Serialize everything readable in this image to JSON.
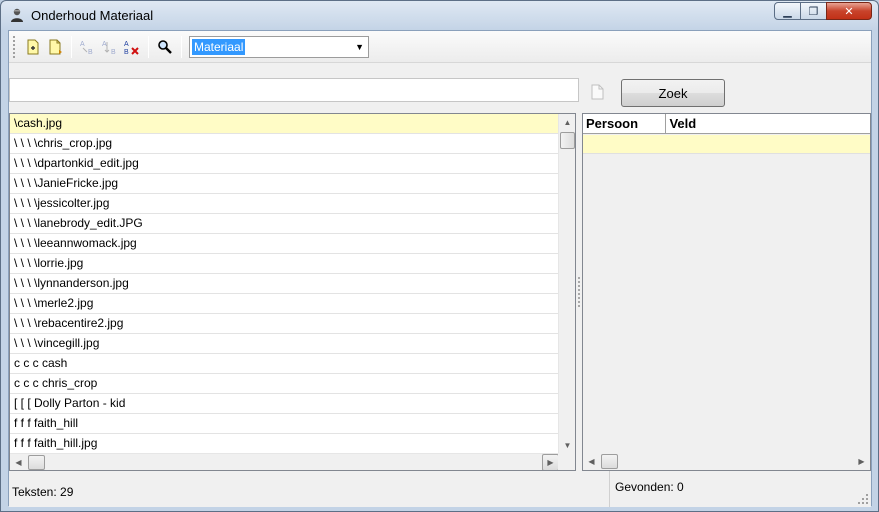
{
  "window": {
    "title": "Onderhoud Materiaal",
    "minimize_glyph": "▁",
    "maximize_glyph": "❐",
    "close_glyph": "✕"
  },
  "toolbar": {
    "buttons": [
      {
        "name": "new-record-icon",
        "enabled": true
      },
      {
        "name": "new-document-icon",
        "enabled": true
      },
      {
        "name": "sort-az-icon",
        "enabled": false
      },
      {
        "name": "sort-za-icon",
        "enabled": false
      },
      {
        "name": "delete-sort-icon",
        "enabled": true
      },
      {
        "name": "search-icon",
        "enabled": true
      }
    ],
    "combo": {
      "selected": "Materiaal",
      "arrow": "▼"
    }
  },
  "search": {
    "input_value": "",
    "button_label": "Zoek"
  },
  "file_list": {
    "rows": [
      "\\cash.jpg",
      "\\ \\ \\ \\chris_crop.jpg",
      "\\ \\ \\ \\dpartonkid_edit.jpg",
      "\\ \\ \\ \\JanieFricke.jpg",
      "\\ \\ \\ \\jessicolter.jpg",
      "\\ \\ \\ \\lanebrody_edit.JPG",
      "\\ \\ \\ \\leeannwomack.jpg",
      "\\ \\ \\ \\lorrie.jpg",
      "\\ \\ \\ \\lynnanderson.jpg",
      "\\ \\ \\ \\merle2.jpg",
      "\\ \\ \\ \\rebacentire2.jpg",
      "\\ \\ \\ \\vincegill.jpg",
      "c c c cash",
      "c c c chris_crop",
      "[ [ [ Dolly Parton - kid",
      "f f f faith_hill",
      "f f f faith_hill.jpg"
    ],
    "selected_index": 0
  },
  "grid": {
    "columns": [
      "Persoon",
      "Veld"
    ]
  },
  "status": {
    "teksten": "Teksten: 29",
    "gevonden": "Gevonden: 0"
  }
}
